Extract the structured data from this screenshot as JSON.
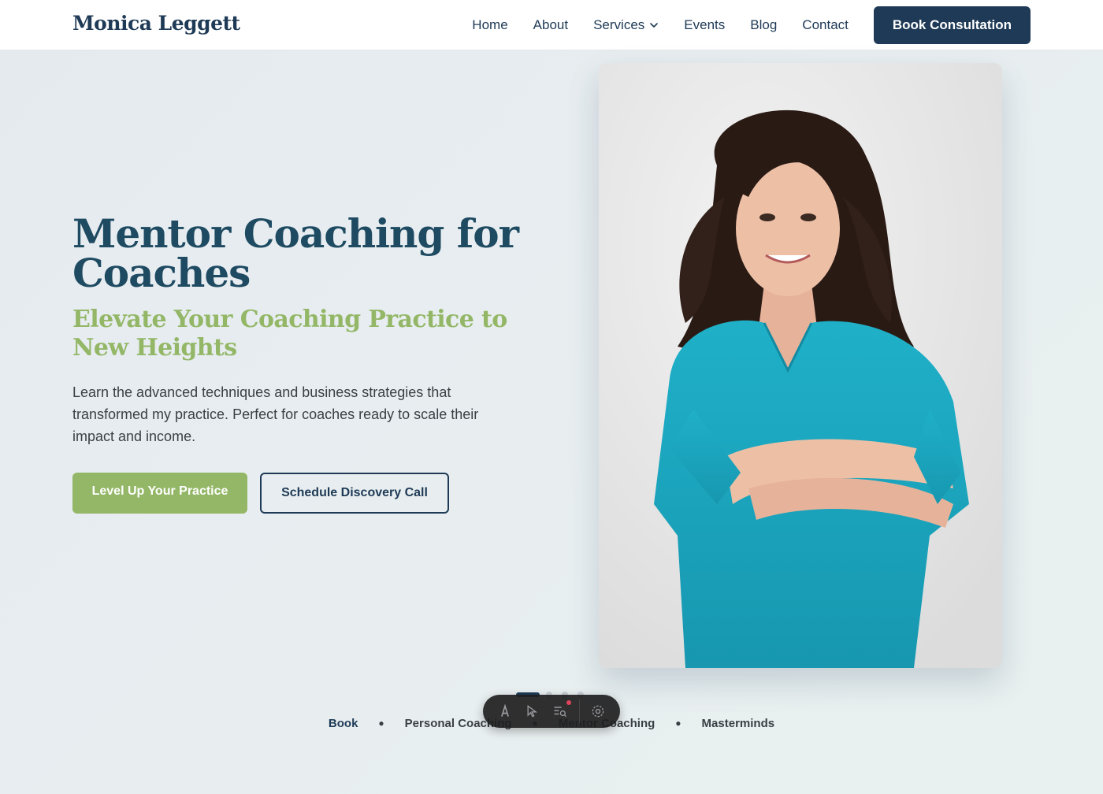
{
  "header": {
    "logo": "Monica Leggett",
    "nav": [
      {
        "label": "Home"
      },
      {
        "label": "About"
      },
      {
        "label": "Services"
      },
      {
        "label": "Events"
      },
      {
        "label": "Blog"
      },
      {
        "label": "Contact"
      }
    ],
    "cta_label": "Book Consultation"
  },
  "hero": {
    "title": "Mentor Coaching for Coaches",
    "subtitle": "Elevate Your Coaching Practice to New Heights",
    "description": "Learn the advanced techniques and business strategies that transformed my practice. Perfect for coaches ready to scale their impact and income.",
    "primary_button": "Level Up Your Practice",
    "secondary_button": "Schedule Discovery Call"
  },
  "bottom_links": [
    {
      "label": "Book",
      "active": true
    },
    {
      "label": "Personal Coaching",
      "active": false
    },
    {
      "label": "Mentor Coaching",
      "active": false
    },
    {
      "label": "Masterminds",
      "active": false
    }
  ],
  "slider": {
    "total": 4,
    "active_index": 0
  },
  "colors": {
    "navy": "#1e3a56",
    "title": "#1e4a62",
    "accent_green": "#93b766",
    "scrubs_teal": "#1ba3bd"
  }
}
